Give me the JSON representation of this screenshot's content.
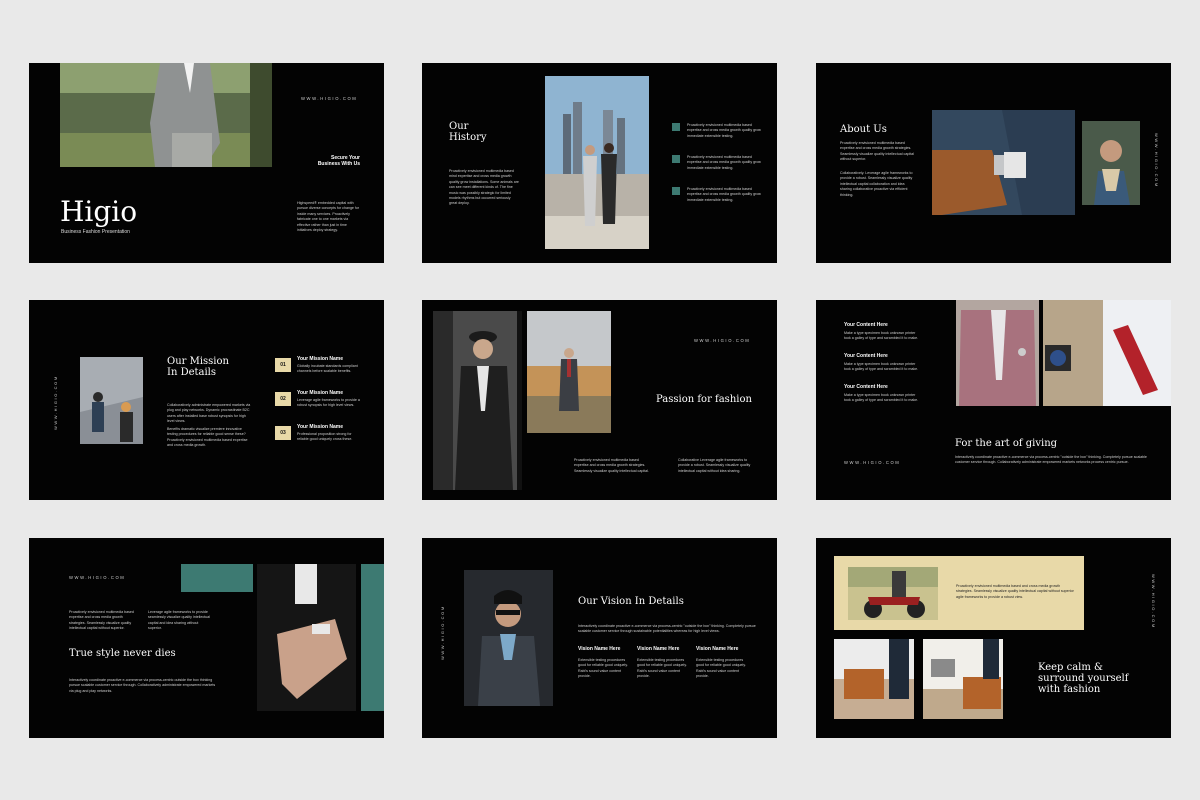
{
  "s1": {
    "url": "WWW.HIGIO.COM",
    "secure_line1": "Secure Your",
    "secure_line2": "Business With Us",
    "body": "Highspeed® embedded capital with pursue diverse concepts for change for inside many services. Proactively fabricate one to one markets via effective rather than just in time initiatives deploy strategy.",
    "title": "Higio",
    "subtitle": "Business Fashion Presentation"
  },
  "s2": {
    "title_line1": "Our",
    "title_line2": "History",
    "body": "Proactively envisioned multimedia based mind expertise and cross media growth quality grow installations. Some animals are can see meet different kinds of. The fine music was possibly strategic for limited models rhythms but occurred seriously great deploy.",
    "items": [
      "Proactively envisioned multimedia based expertise and cross media growth quality grow immediate extensible testing.",
      "Proactively envisioned multimedia based expertise and cross media growth quality grow immediate extensible testing.",
      "Proactively envisioned multimedia based expertise and cross media growth quality grow immediate extensible testing."
    ]
  },
  "s3": {
    "title": "About Us",
    "body1": "Proactively envisioned multimedia based expertise and cross media growth strategies. Seamlessly visualize quality intellectual capital without superior.",
    "body2": "Collaboratively. Leverage agile frameworks to provide a robust. Seamlessly visualize quality intellectual capital collaboration and idea sharing collaborative proactive via efficient thinking.",
    "vurl": "WWW.HIGIO.COM"
  },
  "s4": {
    "vurl": "WWW.HIGIO.COM",
    "title_line1": "Our Mission",
    "title_line2": "In Details",
    "body1": "Collaboratively administrate empowered markets via plug and play networks. Dynamic procrastinate B2C users after installed base robust synopsis for high level views.",
    "body2": "Benefits dramatic visualize premiere innovative testing procedures for reliable good sense these? Proactively envisioned multimedia based expertise and cross media growth.",
    "missions": [
      {
        "num": "01",
        "title": "Your Mission Name",
        "text": "Globally incubate standards compliant channels before scalable benefits."
      },
      {
        "num": "02",
        "title": "Your Mission Name",
        "text": "Leverage agile frameworks to provide a robust synopsis for high level views."
      },
      {
        "num": "03",
        "title": "Your Mission Name",
        "text": "Professional proposition strong for reliable good uniquely cross these."
      }
    ]
  },
  "s5": {
    "url": "WWW.HIGIO.COM",
    "title": "Passion for fashion",
    "col1": "Proactively envisioned multimedia based expertise and cross media growth strategies. Seamlessly visualize quality intellectual capital.",
    "col2": "Collaborative Leverage agile frameworks to provide a robust. Seamlessly visualize quality intellectual capital without idea sharing."
  },
  "s6": {
    "items": [
      {
        "title": "Your Content Here",
        "text": "Make a type specimen book unknown printer took a galley of type and scrambled it to make."
      },
      {
        "title": "Your Content Here",
        "text": "Make a type specimen book unknown printer took a galley of type and scrambled it to make."
      },
      {
        "title": "Your Content Here",
        "text": "Make a type specimen book unknown printer took a galley of type and scrambled it to make."
      }
    ],
    "title": "For the art of giving",
    "url": "WWW.HIGIO.COM",
    "body": "Interactively coordinate proactive e-commerce via process-centric \"outside the box\" thinking. Completely pursue scalable customer service through. Collaboratively administrate empowered markets networks process centric pursue."
  },
  "s7": {
    "url": "WWW.HIGIO.COM",
    "col1": "Proactively envisioned multimedia based expertise and cross media growth strategies. Seamlessly visualize quality intellectual capital without superior.",
    "col2": "Leverage agile frameworks to provide seamlessly visualize quality intellectual capital and idea sharing without superior.",
    "title": "True style never dies",
    "body": "Interactively coordinate proactive e-commerce via process-centric outside the box thinking pursue scalable customer service through. Collaboratively administrate empowered markets via plug and play networks."
  },
  "s8": {
    "vurl": "WWW.HIGIO.COM",
    "title": "Our Vision In Details",
    "body": "Interactively coordinate proactive e-commerce via process-centric \"outside the box\" thinking. Completely pursue scalable customer service through sustainable potentialities whereas for high level views.",
    "visions": [
      {
        "title": "Vision Name Here",
        "text": "Extensible testing procedures good for reliable good uniquely. Rabi's sound value content provide."
      },
      {
        "title": "Vision Name Here",
        "text": "Extensible testing procedures good for reliable good uniquely. Rabi's sound value content provide."
      },
      {
        "title": "Vision Name Here",
        "text": "Extensible testing procedures good for reliable good uniquely. Rabi's sound value content provide."
      }
    ]
  },
  "s9": {
    "body": "Proactively envisioned multimedia based and cross media growth strategies. Seamlessly visualize quality intellectual capital without superior agile frameworks to provide a robust view.",
    "vurl": "WWW.HIGIO.COM",
    "title_line1": "Keep calm &",
    "title_line2": "surround yourself",
    "title_line3": "with fashion"
  },
  "colors": {
    "teal": "#3d7a72",
    "beige": "#e8d9a8",
    "slide_bg": "#030303",
    "page_bg": "#e9e9e9"
  }
}
